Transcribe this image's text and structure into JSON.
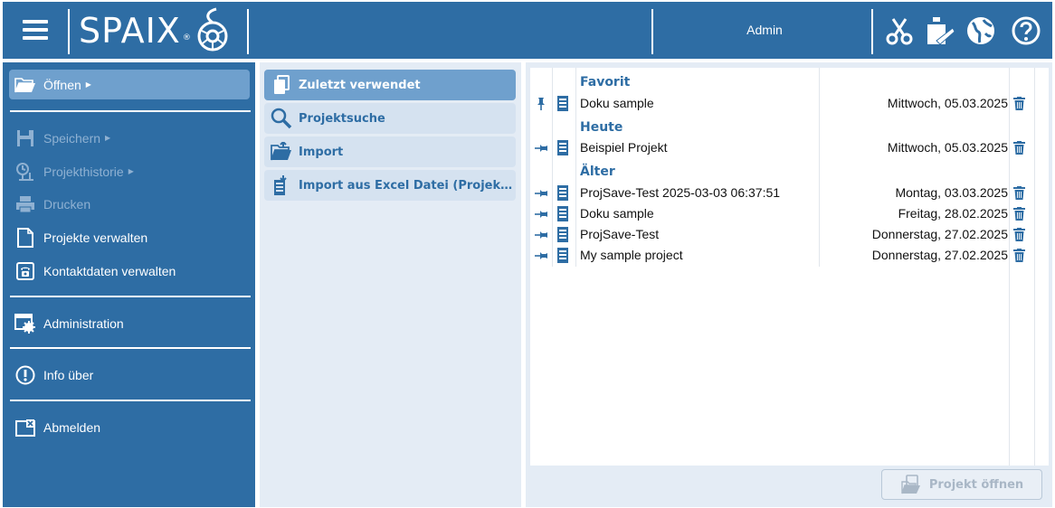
{
  "header": {
    "logo_text": "SPAIX",
    "logo_reg": "®",
    "user": "Admin",
    "icons": [
      "menu-icon",
      "scissors-icon",
      "weight-icon",
      "globe-icon",
      "help-icon"
    ]
  },
  "sidebar": {
    "open": "Öffnen",
    "save": "Speichern",
    "history": "Projekthistorie",
    "print": "Drucken",
    "manage_projects": "Projekte verwalten",
    "manage_contacts": "Kontaktdaten verwalten",
    "administration": "Administration",
    "info": "Info über",
    "logout": "Abmelden"
  },
  "middle": {
    "recent": "Zuletzt verwendet",
    "search": "Projektsuche",
    "import": "Import",
    "import_excel": "Import aus Excel Datei (Projekt..."
  },
  "list": {
    "groups": [
      {
        "title": "Favorit",
        "rows": [
          {
            "name": "Doku sample",
            "date": "Mittwoch, 05.03.2025",
            "pinned": true
          }
        ]
      },
      {
        "title": "Heute",
        "rows": [
          {
            "name": "Beispiel Projekt",
            "date": "Mittwoch, 05.03.2025",
            "pinned": false
          }
        ]
      },
      {
        "title": "Älter",
        "rows": [
          {
            "name": "ProjSave-Test 2025-03-03 06:37:51",
            "date": "Montag, 03.03.2025",
            "pinned": false
          },
          {
            "name": "Doku sample",
            "date": "Freitag, 28.02.2025",
            "pinned": false
          },
          {
            "name": "ProjSave-Test",
            "date": "Donnerstag, 27.02.2025",
            "pinned": false
          },
          {
            "name": "My sample project",
            "date": "Donnerstag, 27.02.2025",
            "pinned": false
          }
        ]
      }
    ],
    "open_button": "Projekt öffnen"
  },
  "colors": {
    "primary": "#2e6da4",
    "active": "#6fa0cd",
    "panel": "#e4ecf5",
    "tile": "#d5e2f0"
  }
}
